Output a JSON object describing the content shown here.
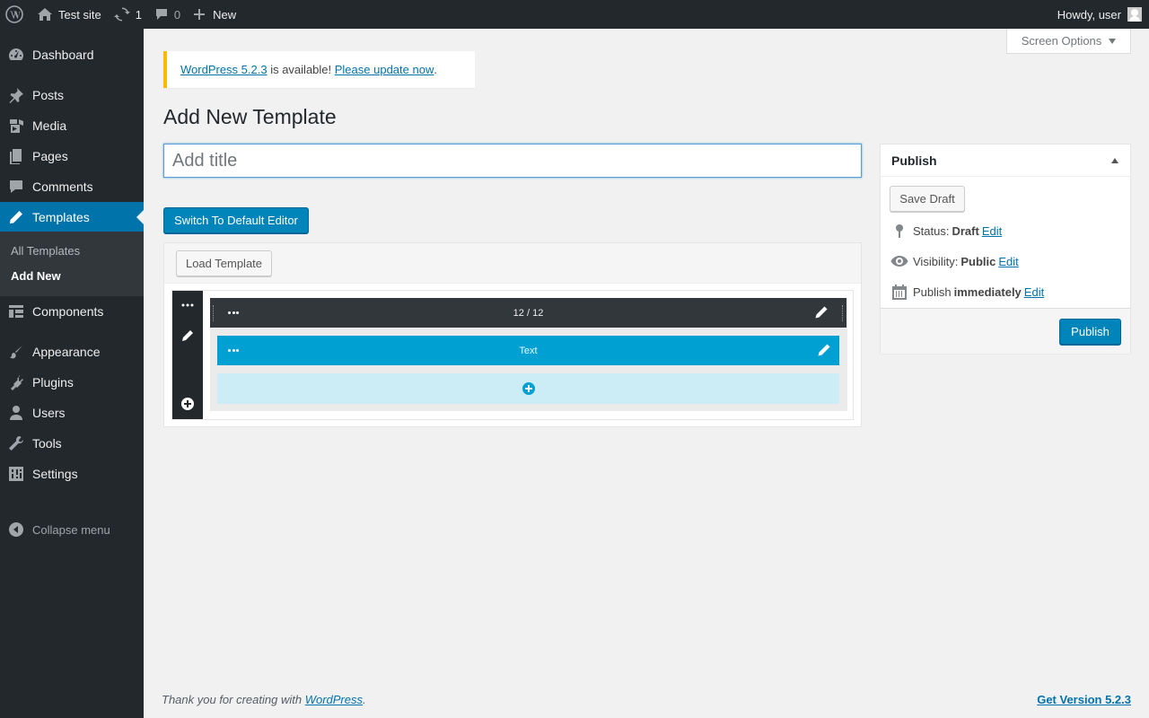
{
  "adminbar": {
    "site_name": "Test site",
    "updates_count": "1",
    "comments_count": "0",
    "new_label": "New",
    "howdy": "Howdy, user"
  },
  "sidebar": {
    "items": [
      {
        "label": "Dashboard",
        "icon": "dashboard-icon"
      },
      {
        "label": "Posts",
        "icon": "pin-icon"
      },
      {
        "label": "Media",
        "icon": "media-icon"
      },
      {
        "label": "Pages",
        "icon": "pages-icon"
      },
      {
        "label": "Comments",
        "icon": "comment-icon"
      },
      {
        "label": "Templates",
        "icon": "pencil-icon"
      },
      {
        "label": "Components",
        "icon": "components-icon"
      },
      {
        "label": "Appearance",
        "icon": "brush-icon"
      },
      {
        "label": "Plugins",
        "icon": "plugin-icon"
      },
      {
        "label": "Users",
        "icon": "user-icon"
      },
      {
        "label": "Tools",
        "icon": "wrench-icon"
      },
      {
        "label": "Settings",
        "icon": "settings-icon"
      }
    ],
    "submenu": [
      "All Templates",
      "Add New"
    ],
    "collapse_label": "Collapse menu"
  },
  "screen_options": "Screen Options",
  "notice": {
    "version_link": "WordPress 5.2.3",
    "middle_text": " is available! ",
    "update_link": "Please update now",
    "end_text": "."
  },
  "page_title": "Add New Template",
  "title_input": {
    "placeholder": "Add title",
    "value": ""
  },
  "switch_editor_label": "Switch To Default Editor",
  "load_template_label": "Load Template",
  "builder": {
    "row_label": "12 / 12",
    "module_label": "Text"
  },
  "publish": {
    "heading": "Publish",
    "save_draft": "Save Draft",
    "status_label": "Status:",
    "status_value": "Draft",
    "visibility_label": "Visibility:",
    "visibility_value": "Public",
    "schedule_label": "Publish",
    "schedule_value": "immediately",
    "edit_label": "Edit",
    "publish_button": "Publish"
  },
  "footer": {
    "thanks_prefix": "Thank you for creating with ",
    "thanks_link": "WordPress",
    "thanks_suffix": ".",
    "version_link": "Get Version 5.2.3"
  },
  "colors": {
    "adminbar_bg": "#23282d",
    "accent": "#0073aa",
    "button_primary": "#0085ba",
    "module_blue": "#00a0d2",
    "notice_warning": "#ffb900"
  }
}
